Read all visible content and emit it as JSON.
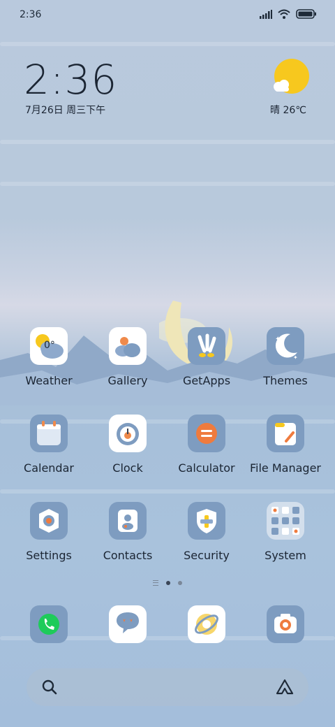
{
  "status_bar": {
    "time": "2:36",
    "icons": [
      "signal-icon",
      "wifi-icon",
      "battery-icon"
    ]
  },
  "clock_widget": {
    "time": "2:36",
    "date": "7月26日 周三下午"
  },
  "weather_widget": {
    "icon": "sun-cloud-icon",
    "text": "晴 26℃"
  },
  "apps": [
    {
      "label": "Weather",
      "icon": "weather-icon",
      "badge": "0°"
    },
    {
      "label": "Gallery",
      "icon": "gallery-icon"
    },
    {
      "label": "GetApps",
      "icon": "getapps-icon"
    },
    {
      "label": "Themes",
      "icon": "themes-icon"
    },
    {
      "label": "Calendar",
      "icon": "calendar-icon"
    },
    {
      "label": "Clock",
      "icon": "clock-icon"
    },
    {
      "label": "Calculator",
      "icon": "calculator-icon"
    },
    {
      "label": "File Manager",
      "icon": "file-manager-icon"
    },
    {
      "label": "Settings",
      "icon": "settings-icon"
    },
    {
      "label": "Contacts",
      "icon": "contacts-icon"
    },
    {
      "label": "Security",
      "icon": "security-icon"
    },
    {
      "label": "System",
      "icon": "system-folder-icon"
    }
  ],
  "page_indicator": {
    "pages": 2,
    "current": 1
  },
  "dock": [
    {
      "icon": "phone-icon"
    },
    {
      "icon": "messages-icon"
    },
    {
      "icon": "browser-icon"
    },
    {
      "icon": "camera-icon"
    }
  ],
  "search_bar": {
    "left_icon": "search-icon",
    "right_icon": "assistant-icon"
  },
  "colors": {
    "accent_blue": "#7e9cc0",
    "sun": "#f7c81e",
    "calculator": "#ef7b3e",
    "phone_green": "#1ecb5a"
  }
}
